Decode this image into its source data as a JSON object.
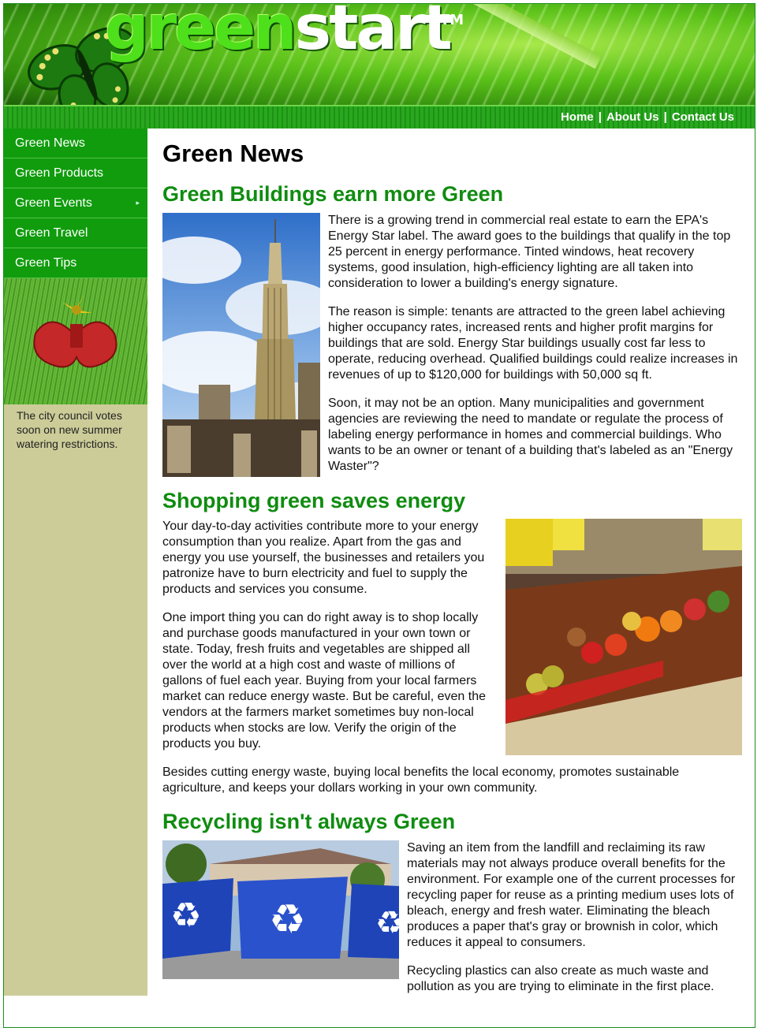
{
  "brand": {
    "name_part1": "green",
    "name_part2": "start",
    "trademark": "TM"
  },
  "top_nav": [
    {
      "label": "Home"
    },
    {
      "label": "About Us"
    },
    {
      "label": "Contact Us"
    }
  ],
  "top_nav_separator": "|",
  "sidebar": {
    "items": [
      {
        "label": "Green News"
      },
      {
        "label": "Green Products"
      },
      {
        "label": "Green Events",
        "has_submenu": true
      },
      {
        "label": "Green Travel"
      },
      {
        "label": "Green Tips"
      }
    ],
    "submenu_arrow": "▸",
    "caption": "The city council votes soon on new summer watering restrictions."
  },
  "main": {
    "title": "Green News",
    "articles": [
      {
        "heading": "Green Buildings earn more Green",
        "paragraphs": [
          "There is a growing trend in commercial real estate to earn the EPA's Energy Star label. The award goes to the buildings that qualify in the top 25 percent in energy performance. Tinted windows, heat recovery systems, good insulation, high-efficiency lighting are all taken into consideration to lower a building's energy signature.",
          "The reason is simple: tenants are attracted to the green label achieving higher occupancy rates, increased rents and higher profit margins for buildings that are sold. Energy Star buildings usually cost far less to operate, reducing overhead. Qualified buildings could realize increases in revenues of up to $120,000 for buildings with 50,000 sq ft.",
          "Soon, it may not be an option. Many municipalities and government agencies are reviewing the need to mandate or regulate the process of labeling energy performance in homes and commercial buildings. Who wants to be an owner or tenant of a building that's labeled as an \"Energy Waster\"?"
        ]
      },
      {
        "heading": "Shopping green saves energy",
        "paragraphs": [
          "Your day-to-day activities contribute more to your energy consumption than you realize. Apart from the gas and energy you use yourself, the businesses and retailers you patronize have to burn electricity and fuel to supply the products and services you consume.",
          "One import thing you can do right away is to shop locally and purchase goods manufactured in your own town or state. Today, fresh fruits and vegetables are shipped all over the world at a high cost and waste of millions of gallons of fuel each year. Buying from your local farmers market can reduce energy waste. But be careful, even the vendors at the farmers market sometimes buy non-local products when stocks are low. Verify the origin of the products you buy.",
          "Besides cutting energy waste, buying local benefits the local economy, promotes sustainable agriculture, and keeps your dollars working in your own community."
        ]
      },
      {
        "heading": "Recycling isn't always Green",
        "paragraphs": [
          "Saving an item from the landfill and reclaiming its raw materials may not always produce overall benefits for the environment. For example one of the current processes for recycling paper for reuse as a printing medium uses lots of bleach, energy and fresh water. Eliminating the bleach produces a paper that's gray or brownish in color, which reduces it appeal to consumers.",
          "Recycling plastics can also create as much waste and pollution as you are trying to eliminate in the first place."
        ]
      }
    ]
  },
  "colors": {
    "brand_green": "#108c10",
    "nav_green": "#109c0d",
    "sidebar_tan": "#cccc99"
  }
}
